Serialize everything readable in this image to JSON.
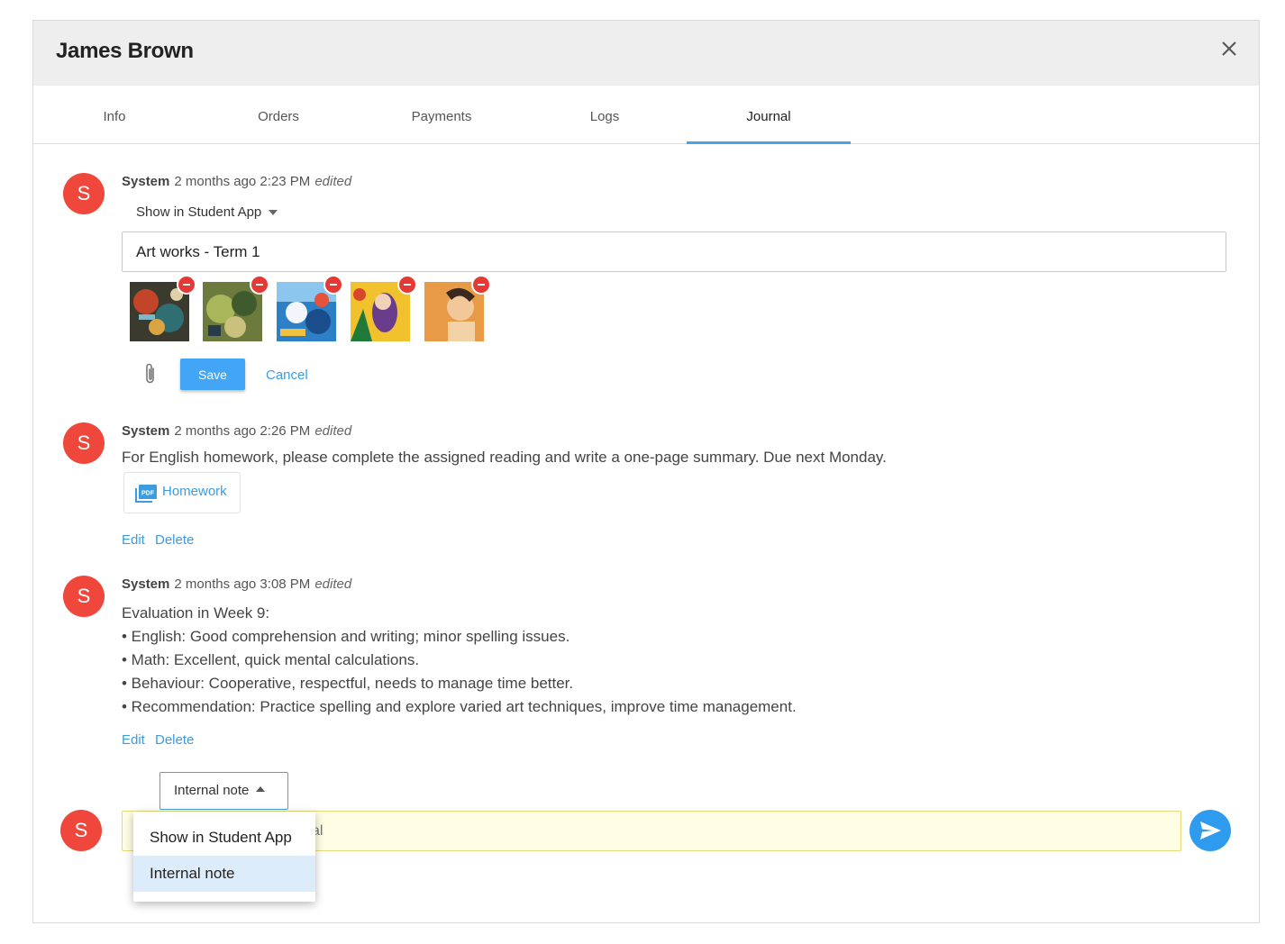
{
  "dialog": {
    "title": "James Brown",
    "close_icon": "close-icon"
  },
  "tabs": [
    {
      "label": "Info"
    },
    {
      "label": "Orders"
    },
    {
      "label": "Payments"
    },
    {
      "label": "Logs"
    },
    {
      "label": "Journal",
      "active": true
    }
  ],
  "entries": [
    {
      "avatar": "S",
      "author": "System",
      "time": "2 months ago 2:23 PM",
      "edited": "edited",
      "visibility": "Show in Student App",
      "title_value": "Art works - Term 1",
      "images": [
        "artwork-1",
        "artwork-2",
        "artwork-3",
        "artwork-4",
        "artwork-5"
      ],
      "save_label": "Save",
      "cancel_label": "Cancel"
    },
    {
      "avatar": "S",
      "author": "System",
      "time": "2 months ago 2:26 PM",
      "edited": "edited",
      "text": "For English homework, please complete the assigned reading and write a one-page summary.  Due next Monday.",
      "attachment": "Homework",
      "edit_label": "Edit",
      "delete_label": "Delete"
    },
    {
      "avatar": "S",
      "author": "System",
      "time": "2 months ago 3:08 PM",
      "edited": "edited",
      "lines": [
        "Evaluation in Week 9:",
        "• English: Good comprehension and writing; minor spelling issues.",
        "• Math: Excellent, quick mental calculations.",
        "• Behaviour: Cooperative, respectful, needs to manage time better.",
        "• Recommendation: Practice spelling and explore varied art techniques, improve time management."
      ],
      "edit_label": "Edit",
      "delete_label": "Delete"
    }
  ],
  "composer": {
    "avatar": "S",
    "note_type": "Internal note",
    "placeholder_visible": "al",
    "dropdown_options": [
      "Show in Student App",
      "Internal note"
    ],
    "selected_option": "Internal note"
  },
  "colors": {
    "accent": "#42a5f5",
    "avatar": "#f0473c",
    "link": "#3d9be0",
    "compose_bg": "#fffde3"
  }
}
